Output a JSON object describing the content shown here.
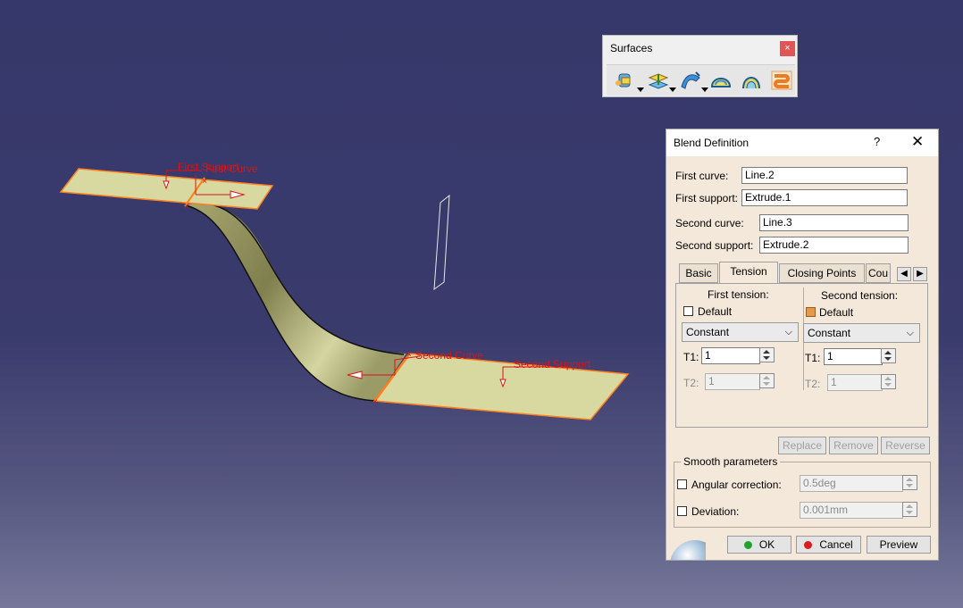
{
  "viewport": {
    "first_support_label": "First Support",
    "first_curve_label": "First Curve",
    "second_curve_label": "Second Curve",
    "second_support_label": "Second Support"
  },
  "toolbar": {
    "title": "Surfaces",
    "close": "×",
    "icons": [
      "extrude-icon",
      "offset-icon",
      "sweep-icon",
      "fill-icon",
      "multisection-icon",
      "blend-icon"
    ]
  },
  "dialog": {
    "title": "Blend Definition",
    "help": "?",
    "close": "✕",
    "first_curve_label": "First curve:",
    "first_curve_value": "Line.2",
    "first_support_label": "First support:",
    "first_support_value": "Extrude.1",
    "second_curve_label": "Second curve:",
    "second_curve_value": "Line.3",
    "second_support_label": "Second support:",
    "second_support_value": "Extrude.2",
    "tabs": [
      "Basic",
      "Tension",
      "Closing Points",
      "Cou"
    ],
    "first_tension": {
      "title": "First tension:",
      "default_label": "Default",
      "default_checked": false,
      "mode": "Constant",
      "t1_label": "T1:",
      "t1_value": "1",
      "t2_label": "T2:",
      "t2_value": "1"
    },
    "second_tension": {
      "title": "Second tension:",
      "default_label": "Default",
      "default_checked": true,
      "mode": "Constant",
      "t1_label": "T1:",
      "t1_value": "1",
      "t2_label": "T2:",
      "t2_value": "1"
    },
    "replace_label": "Replace",
    "remove_label": "Remove",
    "reverse_label": "Reverse",
    "smooth": {
      "title": "Smooth parameters",
      "angular_label": "Angular correction:",
      "angular_value": "0.5deg",
      "deviation_label": "Deviation:",
      "deviation_value": "0.001mm"
    },
    "ok_label": "OK",
    "cancel_label": "Cancel",
    "preview_label": "Preview"
  },
  "colors": {
    "background": "#383a6c",
    "surface": "#d8d9a0",
    "highlight": "#ff7f1e",
    "annotation": "#d81414"
  }
}
